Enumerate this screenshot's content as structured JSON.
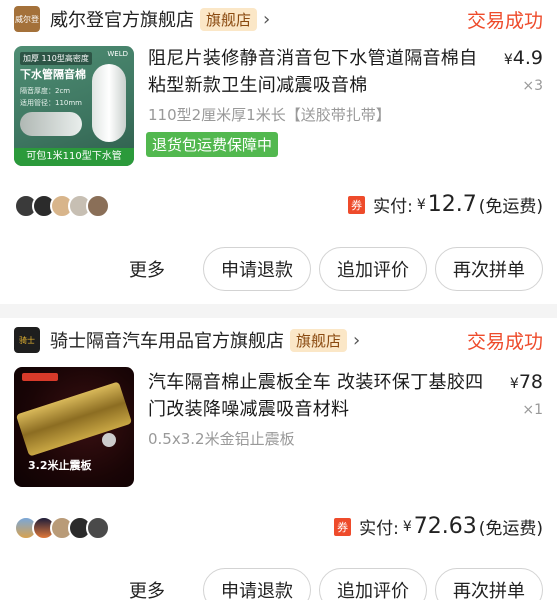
{
  "orders": [
    {
      "store": {
        "logo_text": "威尔登",
        "name": "威尔登官方旗舰店",
        "badge": "旗舰店",
        "chevron": "›"
      },
      "status": "交易成功",
      "thumb": {
        "tag": "加厚",
        "tag2": "110型高密度",
        "headline": "下水管隔音棉",
        "line1": "隔音厚度：2cm",
        "line2": "适用管径：110mm",
        "brand": "WELD",
        "caption": "可包1米110型下水管"
      },
      "title": "阻尼片装修静音消音包下水管道隔音棉自粘型新款卫生间减震吸音棉",
      "spec": "110型2厘米厚1米长【送胶带扎带】",
      "guarantee": "退货包运费保障中",
      "price": {
        "currency": "¥",
        "value": "4.9"
      },
      "quantity": "×3",
      "paid": {
        "coupon": "券",
        "label": "实付:",
        "currency": "¥",
        "amount": "12.7",
        "shipping": "(免运费)"
      },
      "actions": {
        "more": "更多",
        "refund": "申请退款",
        "review": "追加评价",
        "rebuy": "再次拼单"
      }
    },
    {
      "store": {
        "logo_text": "骑士",
        "name": "骑士隔音汽车用品官方旗舰店",
        "badge": "旗舰店",
        "chevron": "›"
      },
      "status": "交易成功",
      "thumb": {
        "caption": "3.2米止震板"
      },
      "title": "汽车隔音棉止震板全车 改装环保丁基胶四门改装降噪减震吸音材料",
      "spec": "0.5x3.2米金铝止震板",
      "price": {
        "currency": "¥",
        "value": "78"
      },
      "quantity": "×1",
      "paid": {
        "coupon": "券",
        "label": "实付:",
        "currency": "¥",
        "amount": "72.63",
        "shipping": "(免运费)"
      },
      "actions": {
        "more": "更多",
        "refund": "申请退款",
        "review": "追加评价",
        "rebuy": "再次拼单"
      }
    }
  ]
}
